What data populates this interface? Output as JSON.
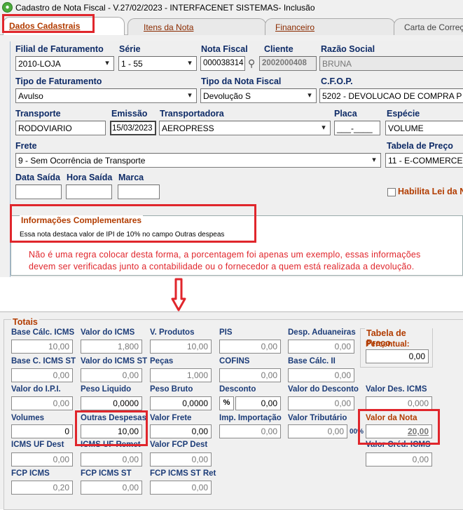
{
  "window": {
    "title": "Cadastro de Nota Fiscal - V.27/02/2023 - INTERFACENET SISTEMAS- Inclusão"
  },
  "tabs": [
    {
      "label": "Dados Cadastrais",
      "active": true
    },
    {
      "label": "Itens da Nota",
      "active": false
    },
    {
      "label": "Financeiro",
      "active": false
    },
    {
      "label": "Carta de Correção",
      "active": false
    }
  ],
  "form": {
    "filial": {
      "label": "Filial de Faturamento",
      "value": "2010-LOJA"
    },
    "serie": {
      "label": "Série",
      "value": "1 - 55"
    },
    "nota_fiscal": {
      "label": "Nota Fiscal",
      "value": "000038314"
    },
    "cliente": {
      "label": "Cliente",
      "value": "2002000408"
    },
    "razao_social": {
      "label": "Razão Social",
      "value": "BRUNA"
    },
    "tipo_faturamento": {
      "label": "Tipo de Faturamento",
      "value": "Avulso"
    },
    "tipo_nota": {
      "label": "Tipo da Nota Fiscal",
      "value": "Devolução S"
    },
    "cfop": {
      "label": "C.F.O.P.",
      "value": "5202 - DEVOLUCAO DE COMPRA P"
    },
    "transporte": {
      "label": "Transporte",
      "value": "RODOVIARIO"
    },
    "emissao": {
      "label": "Emissão",
      "value": "15/03/2023"
    },
    "transportadora": {
      "label": "Transportadora",
      "value": "AEROPRESS"
    },
    "placa": {
      "label": "Placa",
      "value": "___-____"
    },
    "especie": {
      "label": "Espécie",
      "value": "VOLUME"
    },
    "frete": {
      "label": "Frete",
      "value": "9 - Sem Ocorrência de Transporte"
    },
    "tabela_preco": {
      "label": "Tabela de Preço",
      "value": "11 - E-COMMERCE"
    },
    "data_saida": {
      "label": "Data Saída",
      "value": ""
    },
    "hora_saida": {
      "label": "Hora Saída",
      "value": ""
    },
    "marca": {
      "label": "Marca",
      "value": ""
    },
    "habilita_lei": {
      "label": "Habilita Lei da N",
      "checked": false
    },
    "info_comp": {
      "label": "Informações Complementares",
      "value": "Essa nota destaca valor de IPI de 10% no campo Outras despeas"
    }
  },
  "annotation": {
    "line1": "Não é uma regra colocar desta forma, a porcentagem foi apenas um exemplo, essas informações",
    "line2": "devem ser verificadas junto a contabilidade ou o fornecedor a quem está realizada a devolução."
  },
  "totais": {
    "legend": "Totais",
    "base_icms": {
      "label": "Base Cálc. ICMS",
      "value": "10,00"
    },
    "valor_icms": {
      "label": "Valor do ICMS",
      "value": "1,800"
    },
    "v_produtos": {
      "label": "V. Produtos",
      "value": "10,00"
    },
    "pis": {
      "label": "PIS",
      "value": "0,00"
    },
    "desp_aduaneiras": {
      "label": "Desp. Aduaneiras",
      "value": "0,00"
    },
    "base_icms_st": {
      "label": "Base C. ICMS ST",
      "value": "0,00"
    },
    "valor_icms_st": {
      "label": "Valor do ICMS ST",
      "value": "0,00"
    },
    "pecas": {
      "label": "Peças",
      "value": "1,000"
    },
    "cofins": {
      "label": "COFINS",
      "value": "0,00"
    },
    "base_ii": {
      "label": "Base Cálc. II",
      "value": "0,00"
    },
    "valor_ipi": {
      "label": "Valor do I.P.I.",
      "value": "0,00"
    },
    "peso_liquido": {
      "label": "Peso Liquido",
      "value": "0,0000"
    },
    "peso_bruto": {
      "label": "Peso Bruto",
      "value": "0,0000"
    },
    "desconto": {
      "label": "Desconto",
      "prefix": "%",
      "value": "0,00"
    },
    "valor_desconto": {
      "label": "Valor do Desconto",
      "value": "0,00"
    },
    "valor_des_icms": {
      "label": "Valor Des. ICMS",
      "value": "0,000"
    },
    "volumes": {
      "label": "Volumes",
      "value": "0"
    },
    "outras_despesas": {
      "label": "Outras Despesas",
      "value": "10,00"
    },
    "valor_frete": {
      "label": "Valor Frete",
      "value": "0,00"
    },
    "imp_importacao": {
      "label": "Imp. Importação",
      "value": "0,00"
    },
    "valor_tributario": {
      "label": "Valor Tributário",
      "value": "0,00",
      "suffix": "00%"
    },
    "valor_nota": {
      "label": "Valor da Nota",
      "value": "20,00"
    },
    "icms_uf_dest": {
      "label": "ICMS UF Dest",
      "value": "0,00"
    },
    "icms_uf_remet": {
      "label": "ICMS UF Remet",
      "value": "0,00"
    },
    "valor_fcp_dest": {
      "label": "Valor FCP Dest",
      "value": "0,00"
    },
    "valor_cred_icms": {
      "label": "Valor Créd. ICMS",
      "value": "0,00"
    },
    "fcp_icms": {
      "label": "FCP ICMS",
      "value": "0,20"
    },
    "fcp_icms_st": {
      "label": "FCP ICMS ST",
      "value": "0,00"
    },
    "fcp_icms_st_ret": {
      "label": "FCP ICMS ST Ret",
      "value": "0,00"
    },
    "tabela_preco_box": {
      "legend": "Tabela de Preço",
      "sub": "Percentual:",
      "value": "0,00"
    }
  },
  "colors": {
    "annotation_red": "#e0262c",
    "label_blue": "#0d2a66",
    "legend_orange": "#b23c00"
  }
}
